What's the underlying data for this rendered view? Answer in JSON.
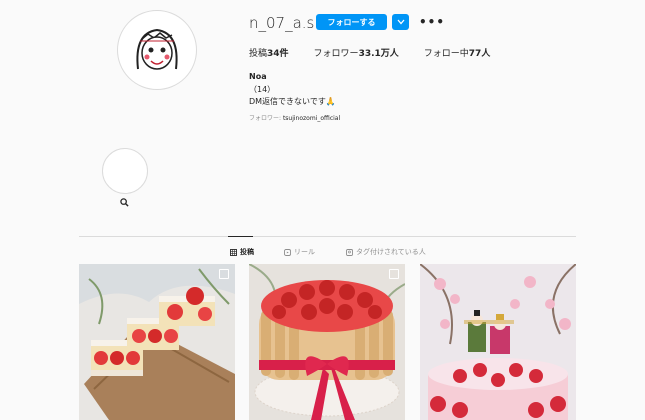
{
  "profile": {
    "username": "n_07_a.s",
    "follow_label": "フォローする",
    "more_icon": "more-horizontal-icon",
    "stats": {
      "posts_label": "投稿",
      "posts_value": "34件",
      "followers_label": "フォロワー",
      "followers_value": "33.1万人",
      "following_label": "フォロー中",
      "following_value": "77人"
    },
    "name": "Noa",
    "bio_line1": "（14）",
    "bio_line2": "DM返信できないです🙏",
    "followed_by_label": "フォロワー: ",
    "followed_by_user": "tsujinozomi_official"
  },
  "tabs": [
    {
      "label": "投稿",
      "icon": "grid-icon",
      "active": true
    },
    {
      "label": "リール",
      "icon": "reels-icon",
      "active": false
    },
    {
      "label": "タグ付けされている人",
      "icon": "tag-user-icon",
      "active": false
    }
  ],
  "colors": {
    "accent": "#0095f6",
    "text": "#262626",
    "muted": "#8e8e8e",
    "border": "#dbdbdb",
    "background": "#fafafa"
  }
}
